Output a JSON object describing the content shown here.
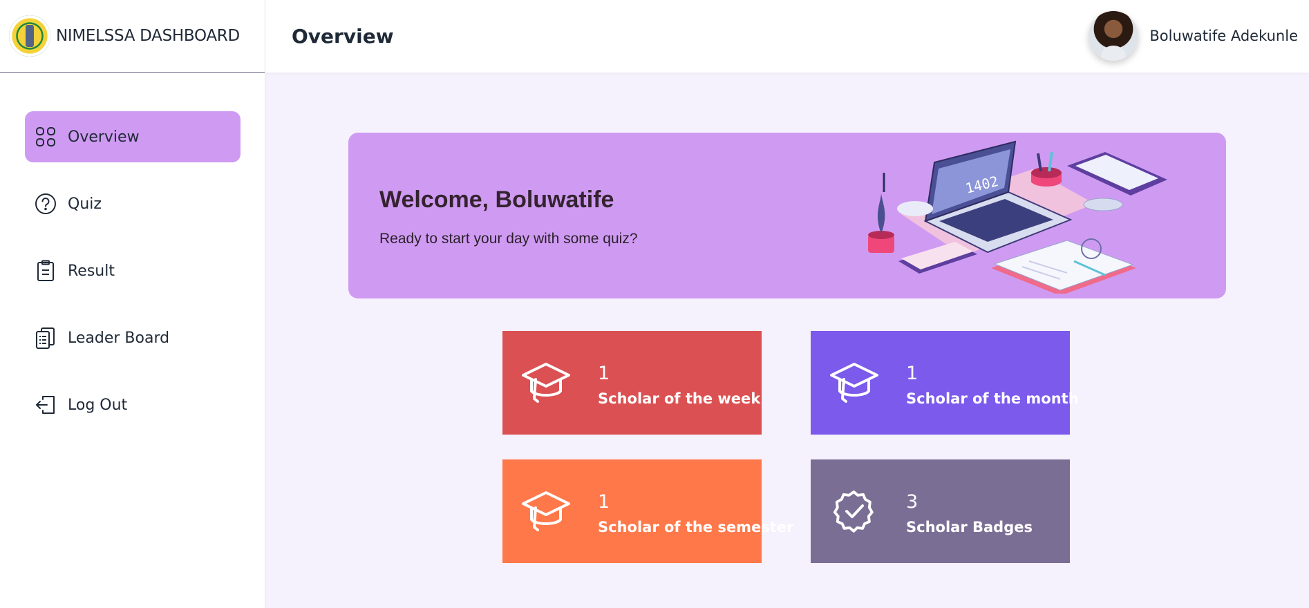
{
  "brand": {
    "title": "NIMELSSA DASHBOARD",
    "logo": "nimelssa-logo"
  },
  "sidebar": {
    "items": [
      {
        "label": "Overview",
        "icon": "grid-icon",
        "active": true
      },
      {
        "label": "Quiz",
        "icon": "question-circle-icon"
      },
      {
        "label": "Result",
        "icon": "clipboard-icon"
      },
      {
        "label": "Leader Board",
        "icon": "clipboard-list-icon"
      },
      {
        "label": "Log Out",
        "icon": "logout-icon"
      }
    ]
  },
  "header": {
    "title": "Overview",
    "user_name": "Boluwatife Adekunle"
  },
  "banner": {
    "title": "Welcome, Boluwatife",
    "subtitle": "Ready to start your day with some quiz?",
    "illustration_text": "1402"
  },
  "stats": [
    {
      "count": "1",
      "label": "Scholar of the week",
      "color": "#db5153",
      "icon": "graduation-cap-icon"
    },
    {
      "count": "1",
      "label": "Scholar of the month",
      "color": "#7b5aec",
      "icon": "graduation-cap-icon"
    },
    {
      "count": "1",
      "label": "Scholar of the semester",
      "color": "#ff784a",
      "icon": "graduation-cap-icon"
    },
    {
      "count": "3",
      "label": "Scholar Badges",
      "color": "#7b6e95",
      "icon": "badge-check-icon"
    }
  ],
  "colors": {
    "accent": "#cf9bf2",
    "background": "#f5f1fd"
  }
}
